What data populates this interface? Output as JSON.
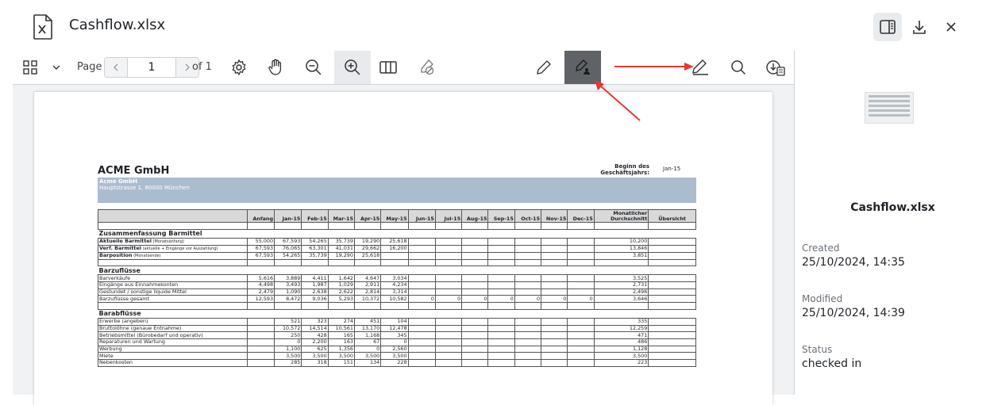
{
  "header": {
    "title": "Cashflow.xlsx"
  },
  "toolbar": {
    "page_label": "Page",
    "page_number": "1",
    "of_label": "of 1"
  },
  "sidepanel": {
    "file_name": "Cashflow.xlsx",
    "created_label": "Created",
    "created_value": "25/10/2024, 14:35",
    "modified_label": "Modified",
    "modified_value": "25/10/2024, 14:39",
    "status_label": "Status",
    "status_value": "checked in"
  },
  "sheet": {
    "company": "ACME GmbH",
    "begin_label": "Beginn des Geschäftsjahrs:",
    "begin_value": "Jan-15",
    "banner_name": "Acme GmbH",
    "banner_address": "Hauptstrasse 1, 80000 München",
    "columns": [
      "",
      "Anfang",
      "Jan-15",
      "Feb-15",
      "Mar-15",
      "Apr-15",
      "May-15",
      "Jun-15",
      "Jul-15",
      "Aug-15",
      "Sep-15",
      "Oct-15",
      "Nov-15",
      "Dec-15",
      "Monatlicher Durchschnitt",
      "Übersicht"
    ],
    "rows": [
      {
        "kind": "gap"
      },
      {
        "kind": "sec",
        "label": "Zusammenfassung Barmittel"
      },
      {
        "kind": "row",
        "label": "Aktuelle Barmittel",
        "note": "(Monatsanfang)",
        "bold": true,
        "vals": [
          "55,000",
          "67,593",
          "54,265",
          "35,739",
          "19,290",
          "25,618",
          "",
          "",
          "",
          "",
          "",
          "",
          "",
          "10,200",
          ""
        ]
      },
      {
        "kind": "row",
        "label": "Verf. Barmittel",
        "note": "(aktuelle + Eingänge vor Auszahlung)",
        "bold": true,
        "vals": [
          "67,593",
          "76,065",
          "63,301",
          "41,031",
          "29,662",
          "16,200",
          "",
          "",
          "",
          "",
          "",
          "",
          "",
          "13,846",
          ""
        ]
      },
      {
        "kind": "row",
        "label": "Barposition",
        "note": "(Monatsende)",
        "bold": true,
        "vals": [
          "67,593",
          "54,265",
          "35,739",
          "19,290",
          "25,618",
          "",
          "",
          "",
          "",
          "",
          "",
          "",
          "",
          "3,851",
          ""
        ]
      },
      {
        "kind": "gap"
      },
      {
        "kind": "sec",
        "label": "Barzuflüsse"
      },
      {
        "kind": "row",
        "label": "Barverkäufe",
        "vals": [
          "5,616",
          "3,889",
          "4,411",
          "1,642",
          "4,647",
          "3,034",
          "",
          "",
          "",
          "",
          "",
          "",
          "",
          "3,525",
          ""
        ]
      },
      {
        "kind": "row",
        "label": "Eingänge aus Einnahmekonten",
        "vals": [
          "4,498",
          "3,493",
          "1,987",
          "1,029",
          "2,911",
          "4,234",
          "",
          "",
          "",
          "",
          "",
          "",
          "",
          "2,731",
          ""
        ]
      },
      {
        "kind": "row",
        "label": "Gestundet / sonstige liquide Mittel",
        "vals": [
          "2,479",
          "1,090",
          "2,638",
          "2,622",
          "2,814",
          "3,314",
          "",
          "",
          "",
          "",
          "",
          "",
          "",
          "2,496",
          ""
        ]
      },
      {
        "kind": "row",
        "label": "Barzuflüsse gesamt",
        "vals": [
          "12,593",
          "8,472",
          "9,036",
          "5,293",
          "10,372",
          "10,582",
          "0",
          "0",
          "0",
          "0",
          "0",
          "0",
          "0",
          "3,646",
          ""
        ]
      },
      {
        "kind": "gap"
      },
      {
        "kind": "sec",
        "label": "Barabflüsse"
      },
      {
        "kind": "row",
        "label": "Erwerbe (angeben)",
        "vals": [
          "",
          "521",
          "323",
          "274",
          "451",
          "104",
          "",
          "",
          "",
          "",
          "",
          "",
          "",
          "335",
          ""
        ]
      },
      {
        "kind": "row",
        "label": "Bruttolöhne (genaue Entnahme)",
        "vals": [
          "",
          "10,572",
          "14,514",
          "10,561",
          "13,170",
          "12,478",
          "",
          "",
          "",
          "",
          "",
          "",
          "",
          "12,259",
          ""
        ]
      },
      {
        "kind": "row",
        "label": "Betriebsmittel (Bürobedarf und operativ)",
        "vals": [
          "",
          "250",
          "428",
          "165",
          "1,168",
          "345",
          "",
          "",
          "",
          "",
          "",
          "",
          "",
          "471",
          ""
        ]
      },
      {
        "kind": "row",
        "label": "Reparaturen und Wartung",
        "vals": [
          "",
          "0",
          "2,200",
          "163",
          "67",
          "0",
          "",
          "",
          "",
          "",
          "",
          "",
          "",
          "486",
          ""
        ]
      },
      {
        "kind": "row",
        "label": "Werbung",
        "vals": [
          "",
          "1,100",
          "625",
          "1,356",
          "0",
          "2,560",
          "",
          "",
          "",
          "",
          "",
          "",
          "",
          "1,128",
          ""
        ]
      },
      {
        "kind": "row",
        "label": "Miete",
        "vals": [
          "",
          "3,500",
          "3,500",
          "3,500",
          "3,500",
          "3,500",
          "",
          "",
          "",
          "",
          "",
          "",
          "",
          "3,500",
          ""
        ]
      },
      {
        "kind": "row",
        "label": "Nebenkosten",
        "vals": [
          "",
          "285",
          "318",
          "151",
          "134",
          "228",
          "",
          "",
          "",
          "",
          "",
          "",
          "",
          "223",
          ""
        ]
      }
    ]
  },
  "colors": {
    "annotation": "#e53935",
    "active_tool": "#5f6368",
    "banner": "#acbccf"
  },
  "icons": [
    "file-excel-icon",
    "sidebar-toggle-icon",
    "download-icon",
    "close-icon",
    "grid-view-icon",
    "chevron-down-icon",
    "chevron-left-icon",
    "chevron-right-icon",
    "settings-icon",
    "hand-icon",
    "zoom-out-icon",
    "zoom-in-icon",
    "columns-icon",
    "erase-icon",
    "pen-icon",
    "pen-user-icon",
    "sign-icon",
    "search-icon",
    "download-version-icon"
  ]
}
